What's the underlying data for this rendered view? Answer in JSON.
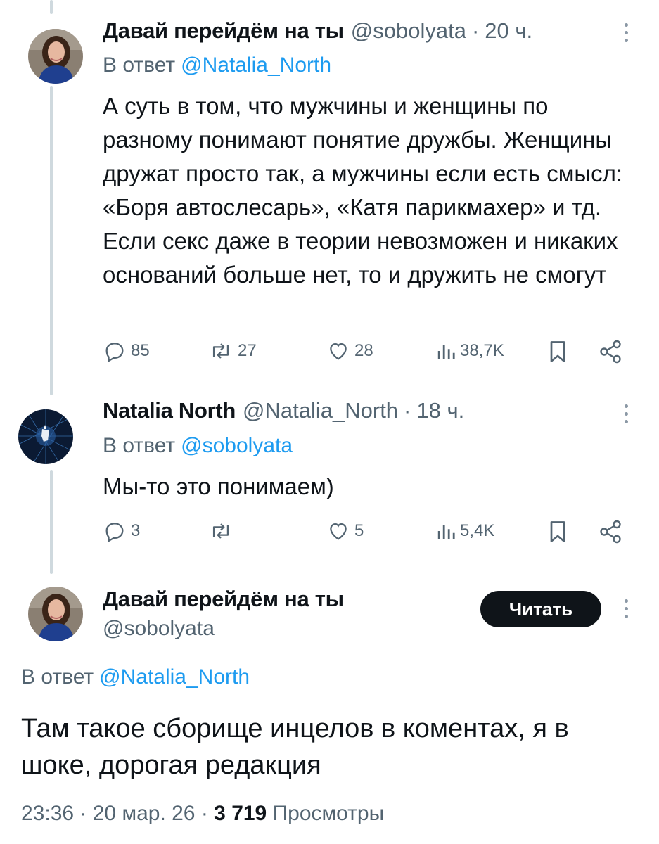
{
  "tweets": [
    {
      "name": "Давай перейдём на ты",
      "handle": "@sobolyata",
      "time": "20 ч.",
      "reply_prefix": "В ответ",
      "reply_to": "@Natalia_North",
      "text": "А суть в том, что мужчины и женщины по разному понимают понятие дружбы. Женщины дружат просто так, а мужчины если есть смысл: «Боря автослесарь», «Катя парикмахер» и тд. Если секс даже в теории невозможен и никаких оснований больше нет, то и дружить не смогут",
      "replies": "85",
      "reposts": "27",
      "likes": "28",
      "views": "38,7K"
    },
    {
      "name": "Natalia North",
      "handle": "@Natalia_North",
      "time": "18 ч.",
      "reply_prefix": "В ответ",
      "reply_to": "@sobolyata",
      "text": "Мы-то это понимаем)",
      "replies": "3",
      "reposts": "",
      "likes": "5",
      "views": "5,4K"
    }
  ],
  "main_tweet": {
    "name": "Давай перейдём на ты",
    "handle": "@sobolyata",
    "follow_label": "Читать",
    "reply_prefix": "В ответ",
    "reply_to": "@Natalia_North",
    "text": "Там такое сборище инцелов в коментах, я в шоке, дорогая редакция",
    "time": "23:36",
    "date": "20 мар. 26",
    "views_count": "3 719",
    "views_label": "Просмотры"
  },
  "icons": [
    "reply-icon",
    "repost-icon",
    "like-icon",
    "views-icon",
    "bookmark-icon",
    "share-icon",
    "more-icon"
  ],
  "colors": {
    "text": "#0f1419",
    "secondary": "#536471",
    "link": "#1d9bf0",
    "thread_line": "#cfd9de",
    "button": "#0f1419"
  }
}
